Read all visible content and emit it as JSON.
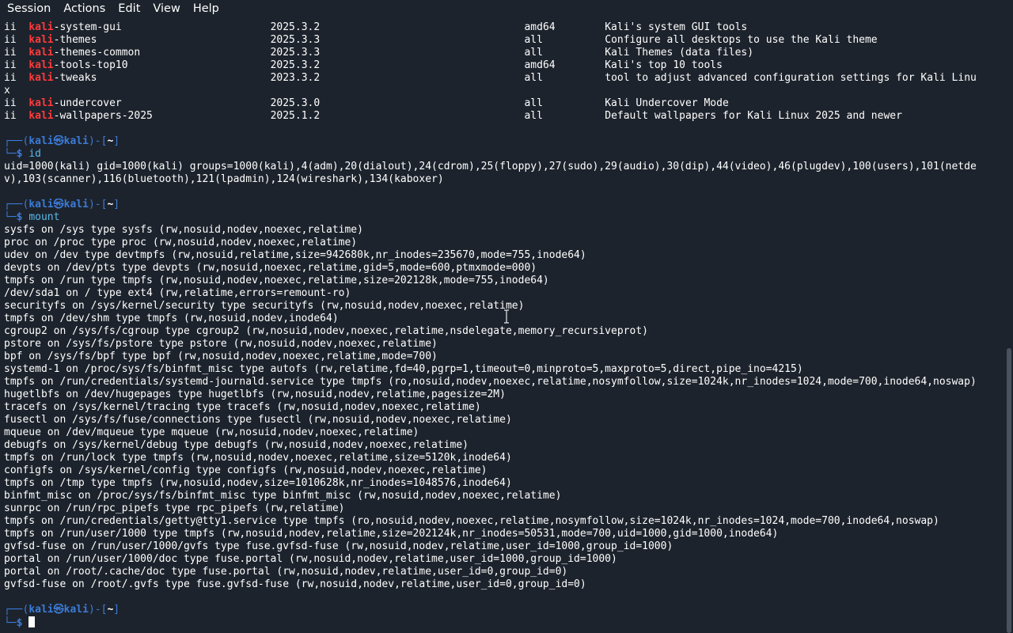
{
  "menu": [
    "Session",
    "Actions",
    "Edit",
    "View",
    "Help"
  ],
  "packages": [
    {
      "status": "ii",
      "prefix": "kali",
      "suffix": "-system-gui",
      "version": "2025.3.2",
      "arch": "amd64",
      "desc": "Kali's system GUI tools"
    },
    {
      "status": "ii",
      "prefix": "kali",
      "suffix": "-themes",
      "version": "2025.3.3",
      "arch": "all",
      "desc": "Configure all desktops to use the Kali theme"
    },
    {
      "status": "ii",
      "prefix": "kali",
      "suffix": "-themes-common",
      "version": "2025.3.3",
      "arch": "all",
      "desc": "Kali Themes (data files)"
    },
    {
      "status": "ii",
      "prefix": "kali",
      "suffix": "-tools-top10",
      "version": "2025.3.2",
      "arch": "amd64",
      "desc": "Kali's top 10 tools"
    },
    {
      "status": "ii",
      "prefix": "kali",
      "suffix": "-tweaks",
      "version": "2023.3.2",
      "arch": "all",
      "desc": "tool to adjust advanced configuration settings for Kali Linu",
      "wrap": "x"
    },
    {
      "status": "ii",
      "prefix": "kali",
      "suffix": "-undercover",
      "version": "2025.3.0",
      "arch": "all",
      "desc": "Kali Undercover Mode"
    },
    {
      "status": "ii",
      "prefix": "kali",
      "suffix": "-wallpapers-2025",
      "version": "2025.1.2",
      "arch": "all",
      "desc": "Default wallpapers for Kali Linux 2025 and newer"
    }
  ],
  "prompt": {
    "top_open": "┌──(",
    "user": "kali",
    "at": "㉿",
    "host": "kali",
    "top_close": ")-[",
    "dir": "~",
    "top_end": "]",
    "bottom": "└─",
    "dollar": "$ "
  },
  "cmd1": "id",
  "id_output": [
    "uid=1000(kali) gid=1000(kali) groups=1000(kali),4(adm),20(dialout),24(cdrom),25(floppy),27(sudo),29(audio),30(dip),44(video),46(plugdev),100(users),101(netde",
    "v),103(scanner),116(bluetooth),121(lpadmin),124(wireshark),134(kaboxer)"
  ],
  "cmd2": "mount",
  "mount_output": [
    "sysfs on /sys type sysfs (rw,nosuid,nodev,noexec,relatime)",
    "proc on /proc type proc (rw,nosuid,nodev,noexec,relatime)",
    "udev on /dev type devtmpfs (rw,nosuid,relatime,size=942680k,nr_inodes=235670,mode=755,inode64)",
    "devpts on /dev/pts type devpts (rw,nosuid,noexec,relatime,gid=5,mode=600,ptmxmode=000)",
    "tmpfs on /run type tmpfs (rw,nosuid,nodev,noexec,relatime,size=202128k,mode=755,inode64)",
    "/dev/sda1 on / type ext4 (rw,relatime,errors=remount-ro)",
    "securityfs on /sys/kernel/security type securityfs (rw,nosuid,nodev,noexec,relatime)",
    "tmpfs on /dev/shm type tmpfs (rw,nosuid,nodev,inode64)",
    "cgroup2 on /sys/fs/cgroup type cgroup2 (rw,nosuid,nodev,noexec,relatime,nsdelegate,memory_recursiveprot)",
    "pstore on /sys/fs/pstore type pstore (rw,nosuid,nodev,noexec,relatime)",
    "bpf on /sys/fs/bpf type bpf (rw,nosuid,nodev,noexec,relatime,mode=700)",
    "systemd-1 on /proc/sys/fs/binfmt_misc type autofs (rw,relatime,fd=40,pgrp=1,timeout=0,minproto=5,maxproto=5,direct,pipe_ino=4215)",
    "tmpfs on /run/credentials/systemd-journald.service type tmpfs (ro,nosuid,nodev,noexec,relatime,nosymfollow,size=1024k,nr_inodes=1024,mode=700,inode64,noswap)",
    "hugetlbfs on /dev/hugepages type hugetlbfs (rw,nosuid,nodev,relatime,pagesize=2M)",
    "tracefs on /sys/kernel/tracing type tracefs (rw,nosuid,nodev,noexec,relatime)",
    "fusectl on /sys/fs/fuse/connections type fusectl (rw,nosuid,nodev,noexec,relatime)",
    "mqueue on /dev/mqueue type mqueue (rw,nosuid,nodev,noexec,relatime)",
    "debugfs on /sys/kernel/debug type debugfs (rw,nosuid,nodev,noexec,relatime)",
    "tmpfs on /run/lock type tmpfs (rw,nosuid,nodev,noexec,relatime,size=5120k,inode64)",
    "configfs on /sys/kernel/config type configfs (rw,nosuid,nodev,noexec,relatime)",
    "tmpfs on /tmp type tmpfs (rw,nosuid,nodev,size=1010628k,nr_inodes=1048576,inode64)",
    "binfmt_misc on /proc/sys/fs/binfmt_misc type binfmt_misc (rw,nosuid,nodev,noexec,relatime)",
    "sunrpc on /run/rpc_pipefs type rpc_pipefs (rw,relatime)",
    "tmpfs on /run/credentials/getty@tty1.service type tmpfs (ro,nosuid,nodev,noexec,relatime,nosymfollow,size=1024k,nr_inodes=1024,mode=700,inode64,noswap)",
    "tmpfs on /run/user/1000 type tmpfs (rw,nosuid,nodev,relatime,size=202124k,nr_inodes=50531,mode=700,uid=1000,gid=1000,inode64)",
    "gvfsd-fuse on /run/user/1000/gvfs type fuse.gvfsd-fuse (rw,nosuid,nodev,relatime,user_id=1000,group_id=1000)",
    "portal on /run/user/1000/doc type fuse.portal (rw,nosuid,nodev,relatime,user_id=1000,group_id=1000)",
    "portal on /root/.cache/doc type fuse.portal (rw,nosuid,nodev,relatime,user_id=0,group_id=0)",
    "gvfsd-fuse on /root/.gvfs type fuse.gvfsd-fuse (rw,nosuid,nodev,relatime,user_id=0,group_id=0)"
  ],
  "colors": {
    "background": "#1d232c",
    "text": "#ffffff",
    "highlight_red": "#ff3b3b",
    "prompt_blue": "#3b7bd8",
    "command_cyan": "#58b8ea"
  },
  "icons": {
    "mouse_cursor": "ibeam-cursor-icon",
    "text_cursor": "block-cursor-icon"
  }
}
